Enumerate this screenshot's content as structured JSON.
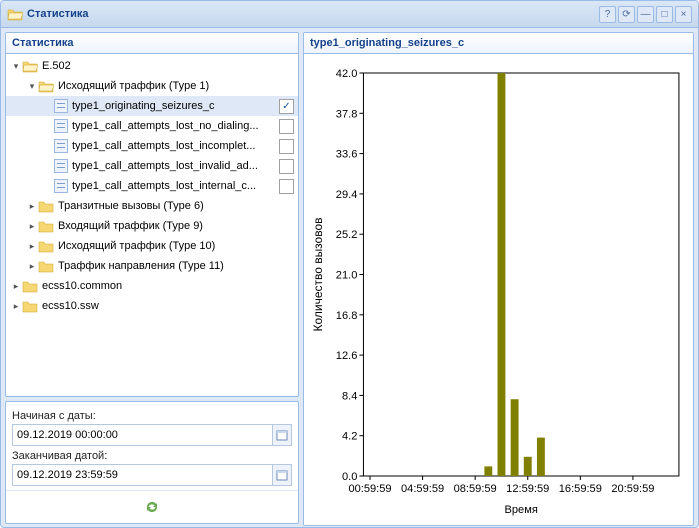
{
  "window": {
    "title": "Статистика"
  },
  "tree": {
    "title": "Статистика",
    "root": {
      "label": "E.502",
      "children": [
        {
          "label": "Исходящий траффик (Type 1)",
          "expanded": true,
          "leaves": [
            {
              "label": "type1_originating_seizures_c",
              "checked": true,
              "selected": true
            },
            {
              "label": "type1_call_attempts_lost_no_dialing...",
              "checked": false
            },
            {
              "label": "type1_call_attempts_lost_incomplet...",
              "checked": false
            },
            {
              "label": "type1_call_attempts_lost_invalid_ad...",
              "checked": false
            },
            {
              "label": "type1_call_attempts_lost_internal_c...",
              "checked": false
            }
          ]
        },
        {
          "label": "Транзитные вызовы (Type 6)",
          "expanded": false
        },
        {
          "label": "Входящий траффик (Type 9)",
          "expanded": false
        },
        {
          "label": "Исходящий траффик (Type 10)",
          "expanded": false
        },
        {
          "label": "Траффик направления (Type 11)",
          "expanded": false
        }
      ]
    },
    "siblings": [
      {
        "label": "ecss10.common"
      },
      {
        "label": "ecss10.ssw"
      }
    ]
  },
  "form": {
    "from_label": "Начиная с даты:",
    "from_value": "09.12.2019 00:00:00",
    "to_label": "Заканчивая датой:",
    "to_value": "09.12.2019 23:59:59"
  },
  "chart_title": "type1_originating_seizures_c",
  "chart_data": {
    "type": "bar",
    "title": "type1_originating_seizures_c",
    "xlabel": "Время",
    "ylabel": "Количество вызовов",
    "ylim": [
      0,
      42
    ],
    "yticks": [
      0.0,
      4.2,
      8.4,
      12.6,
      16.8,
      21.0,
      25.2,
      29.4,
      33.6,
      37.8,
      42.0
    ],
    "xticks": [
      "00:59:59",
      "04:59:59",
      "08:59:59",
      "12:59:59",
      "16:59:59",
      "20:59:59"
    ],
    "categories": [
      "00:59:59",
      "01:59:59",
      "02:59:59",
      "03:59:59",
      "04:59:59",
      "05:59:59",
      "06:59:59",
      "07:59:59",
      "08:59:59",
      "09:59:59",
      "10:59:59",
      "11:59:59",
      "12:59:59",
      "13:59:59",
      "14:59:59",
      "15:59:59",
      "16:59:59",
      "17:59:59",
      "18:59:59",
      "19:59:59",
      "20:59:59",
      "21:59:59",
      "22:59:59",
      "23:59:59"
    ],
    "values": [
      0,
      0,
      0,
      0,
      0,
      0,
      0,
      0,
      0,
      1,
      42,
      8,
      2,
      4,
      0,
      0,
      0,
      0,
      0,
      0,
      0,
      0,
      0,
      0
    ]
  }
}
